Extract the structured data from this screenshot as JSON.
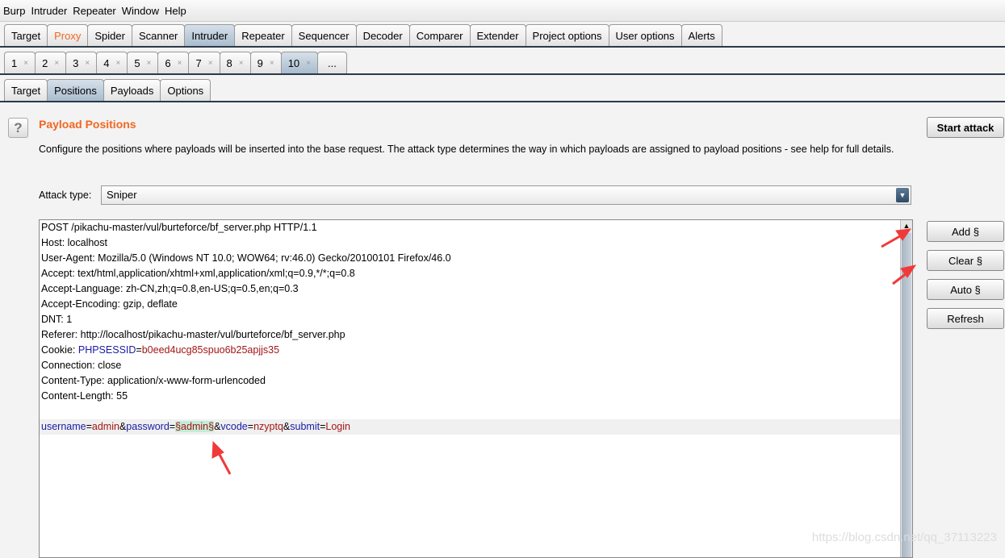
{
  "menu": [
    "Burp",
    "Intruder",
    "Repeater",
    "Window",
    "Help"
  ],
  "main_tabs": [
    {
      "label": "Target"
    },
    {
      "label": "Proxy",
      "color": "#f26722"
    },
    {
      "label": "Spider"
    },
    {
      "label": "Scanner"
    },
    {
      "label": "Intruder",
      "selected": true
    },
    {
      "label": "Repeater"
    },
    {
      "label": "Sequencer"
    },
    {
      "label": "Decoder"
    },
    {
      "label": "Comparer"
    },
    {
      "label": "Extender"
    },
    {
      "label": "Project options"
    },
    {
      "label": "User options"
    },
    {
      "label": "Alerts"
    }
  ],
  "attack_tabs": [
    "1",
    "2",
    "3",
    "4",
    "5",
    "6",
    "7",
    "8",
    "9",
    "10",
    "..."
  ],
  "attack_tab_selected": "10",
  "sub_tabs": [
    "Target",
    "Positions",
    "Payloads",
    "Options"
  ],
  "sub_tab_selected": "Positions",
  "panel": {
    "help": "?",
    "title": "Payload Positions",
    "description": "Configure the positions where payloads will be inserted into the base request. The attack type determines the way in which payloads are assigned to payload positions - see help for full details.",
    "start_attack": "Start attack",
    "attack_type_label": "Attack type:",
    "attack_type": "Sniper"
  },
  "buttons": {
    "add": "Add §",
    "clear": "Clear §",
    "auto": "Auto §",
    "refresh": "Refresh"
  },
  "request": {
    "lines": [
      "POST /pikachu-master/vul/burteforce/bf_server.php HTTP/1.1",
      "Host: localhost",
      "User-Agent: Mozilla/5.0 (Windows NT 10.0; WOW64; rv:46.0) Gecko/20100101 Firefox/46.0",
      "Accept: text/html,application/xhtml+xml,application/xml;q=0.9,*/*;q=0.8",
      "Accept-Language: zh-CN,zh;q=0.8,en-US;q=0.5,en;q=0.3",
      "Accept-Encoding: gzip, deflate",
      "DNT: 1",
      "Referer: http://localhost/pikachu-master/vul/burteforce/bf_server.php"
    ],
    "cookie_prefix": "Cookie: ",
    "cookie_name": "PHPSESSID",
    "cookie_value": "b0eed4ucg85spuo6b25apjjs35",
    "lines2": [
      "Connection: close",
      "Content-Type: application/x-www-form-urlencoded",
      "Content-Length: 55"
    ],
    "body": [
      {
        "t": "username",
        "c": "k"
      },
      {
        "t": "=",
        "c": ""
      },
      {
        "t": "admin",
        "c": "v"
      },
      {
        "t": "&",
        "c": ""
      },
      {
        "t": "password",
        "c": "k"
      },
      {
        "t": "=",
        "c": ""
      },
      {
        "t": "§admin§",
        "c": "mark"
      },
      {
        "t": "&",
        "c": ""
      },
      {
        "t": "vcode",
        "c": "k"
      },
      {
        "t": "=",
        "c": ""
      },
      {
        "t": "nzyptq",
        "c": "v"
      },
      {
        "t": "&",
        "c": ""
      },
      {
        "t": "submit",
        "c": "k"
      },
      {
        "t": "=",
        "c": ""
      },
      {
        "t": "Login",
        "c": "v"
      }
    ]
  },
  "watermark": "https://blog.csdn.net/qq_37113223",
  "colors": {
    "accent": "#f26722",
    "annotation_arrow": "#f03a3a",
    "payload_marker_bg": "#c3ecd9"
  }
}
